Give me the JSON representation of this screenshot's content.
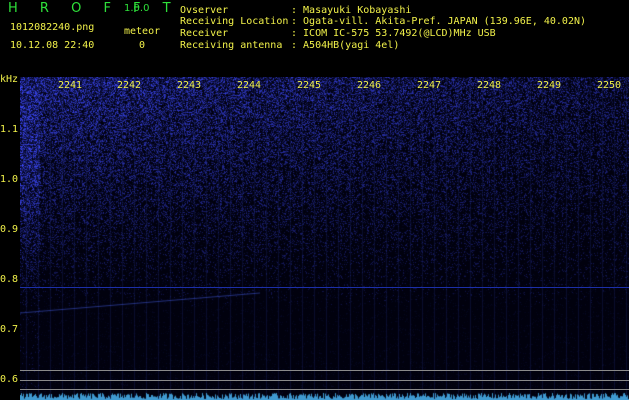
{
  "app": {
    "name": "H R O F F T",
    "version": "1.0.0"
  },
  "file": {
    "filename": "1012082240.png",
    "datetime": "10.12.08 22:40"
  },
  "meteor": {
    "label": "meteor",
    "count": "0"
  },
  "info": [
    {
      "label": "Ovserver",
      "value": ": Masayuki Kobayashi"
    },
    {
      "label": "Receiving Location",
      "value": ": Ogata-vill. Akita-Pref. JAPAN (139.96E, 40.02N)"
    },
    {
      "label": "Receiver",
      "value": ": ICOM IC-575 53.7492(@LCD)MHz USB"
    },
    {
      "label": "Receiving antenna",
      "value": ": A504HB(yagi 4el)"
    }
  ],
  "y_axis": {
    "unit": "kHz",
    "ticks": [
      "1.1",
      "1.0",
      "0.9",
      "0.8",
      "0.7",
      "0.6"
    ]
  },
  "x_axis": {
    "ticks": [
      "2241",
      "2242",
      "2243",
      "2244",
      "2245",
      "2246",
      "2247",
      "2248",
      "2249",
      "2250"
    ]
  },
  "colors": {
    "title_green": "#2ee03a",
    "text_yellow": "#f2f24a",
    "signal_blue": "#3a4cff",
    "background": "#000000"
  }
}
